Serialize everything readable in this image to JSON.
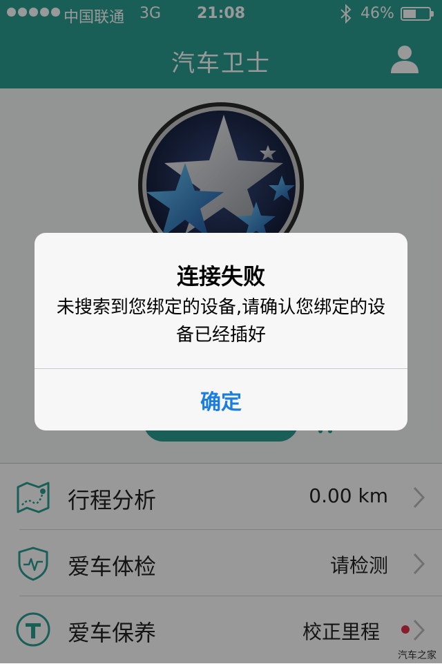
{
  "status_bar": {
    "carrier": "中国联通",
    "network": "3G",
    "time": "21:08",
    "battery": "46%",
    "battery_level": 0.46
  },
  "header": {
    "title": "汽车卫士"
  },
  "list": {
    "items": [
      {
        "label": "行程分析",
        "value": "0.00 km",
        "icon": "map-route-icon"
      },
      {
        "label": "爱车体检",
        "value": "请检测",
        "icon": "shield-heartbeat-icon"
      },
      {
        "label": "爱车保养",
        "value": "校正里程",
        "icon": "wrench-icon"
      }
    ]
  },
  "alert": {
    "title": "连接失败",
    "message": "未搜索到您绑定的设备,请确认您绑定的设备已经插好",
    "confirm_label": "确定"
  },
  "watermark": "汽车之家",
  "colors": {
    "accent": "#2c9e92",
    "link": "#1b7de0",
    "badge": "#e0304a"
  }
}
